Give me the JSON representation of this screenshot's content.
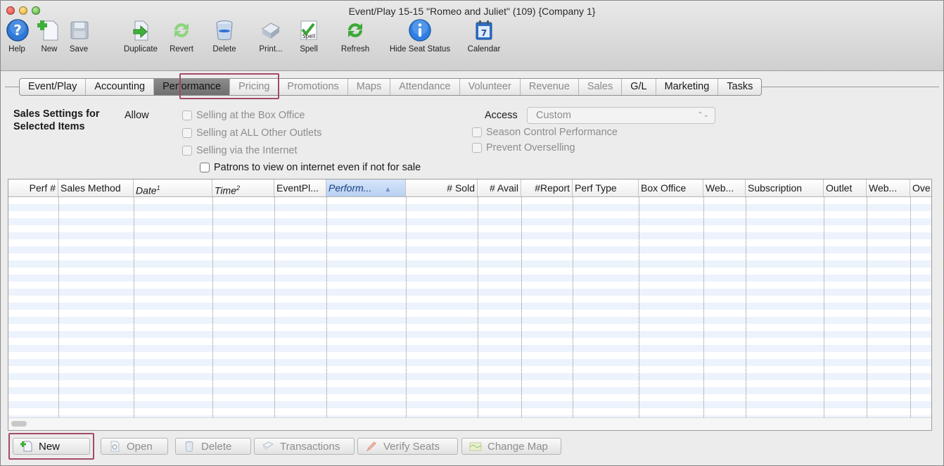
{
  "window": {
    "title": "Event/Play 15-15 \"Romeo and Juliet\" (109) {Company 1}"
  },
  "toolbar": {
    "items": [
      {
        "label": "Help",
        "icon": "help-icon"
      },
      {
        "label": "New",
        "icon": "new-doc-icon"
      },
      {
        "label": "Save",
        "icon": "floppy-icon"
      },
      {
        "label": "Duplicate",
        "icon": "duplicate-icon"
      },
      {
        "label": "Revert",
        "icon": "revert-icon"
      },
      {
        "label": "Delete",
        "icon": "trash-icon"
      },
      {
        "label": "Print...",
        "icon": "printer-icon"
      },
      {
        "label": "Spell",
        "icon": "spellcheck-icon",
        "badge": "Spell"
      },
      {
        "label": "Refresh",
        "icon": "refresh-icon"
      },
      {
        "label": "Hide Seat Status",
        "icon": "info-icon"
      },
      {
        "label": "Calendar",
        "icon": "calendar-icon",
        "badge": "7"
      }
    ]
  },
  "tabs": [
    {
      "label": "Event/Play",
      "state": "normal"
    },
    {
      "label": "Accounting",
      "state": "normal"
    },
    {
      "label": "Performance",
      "state": "active"
    },
    {
      "label": "Pricing",
      "state": "dim"
    },
    {
      "label": "Promotions",
      "state": "dim"
    },
    {
      "label": "Maps",
      "state": "dim"
    },
    {
      "label": "Attendance",
      "state": "dim"
    },
    {
      "label": "Volunteer",
      "state": "dim"
    },
    {
      "label": "Revenue",
      "state": "dim"
    },
    {
      "label": "Sales",
      "state": "dim"
    },
    {
      "label": "G/L",
      "state": "normal"
    },
    {
      "label": "Marketing",
      "state": "normal"
    },
    {
      "label": "Tasks",
      "state": "normal"
    }
  ],
  "settings": {
    "title": "Sales Settings for Selected Items",
    "allow_label": "Allow",
    "allow_options": [
      {
        "label": "Selling at the Box Office",
        "checked": false,
        "enabled": false
      },
      {
        "label": "Selling at ALL Other Outlets",
        "checked": false,
        "enabled": false
      },
      {
        "label": "Selling via the Internet",
        "checked": false,
        "enabled": false
      }
    ],
    "patrons_view": {
      "label": "Patrons to view on internet even if not for sale",
      "checked": false,
      "enabled": true
    },
    "access_label": "Access",
    "access_value": "Custom",
    "access_arrows": "⌃⌄",
    "season_control": {
      "label": "Season Control Performance",
      "checked": false,
      "enabled": false
    },
    "prevent_overselling": {
      "label": "Prevent Overselling",
      "checked": false,
      "enabled": false
    }
  },
  "table": {
    "columns": [
      {
        "label": "Perf #",
        "align": "right"
      },
      {
        "label": "Sales Method",
        "align": "left"
      },
      {
        "label": "Date",
        "sup": "1",
        "italic": true
      },
      {
        "label": "Time",
        "sup": "2",
        "italic": true
      },
      {
        "label": "EventPl...",
        "align": "left"
      },
      {
        "label": "Perform...",
        "sorted": true,
        "sort_indicator": "▲"
      },
      {
        "label": "# Sold",
        "align": "right"
      },
      {
        "label": "# Avail",
        "align": "right"
      },
      {
        "label": "#Report",
        "align": "right"
      },
      {
        "label": "Perf Type",
        "align": "left"
      },
      {
        "label": "Box Office",
        "align": "left"
      },
      {
        "label": "Web...",
        "align": "left"
      },
      {
        "label": "Subscription",
        "align": "left"
      },
      {
        "label": "Outlet",
        "align": "left"
      },
      {
        "label": "Web...",
        "align": "left"
      },
      {
        "label": "Ove.",
        "align": "left"
      }
    ],
    "rows": []
  },
  "buttons": [
    {
      "label": "New",
      "enabled": true,
      "icon": "new-icon"
    },
    {
      "label": "Open",
      "enabled": false,
      "icon": "open-icon"
    },
    {
      "label": "Delete",
      "enabled": false,
      "icon": "delete-icon"
    },
    {
      "label": "Transactions",
      "enabled": false,
      "icon": "transactions-icon"
    },
    {
      "label": "Verify Seats",
      "enabled": false,
      "icon": "verify-seats-icon"
    },
    {
      "label": "Change Map",
      "enabled": false,
      "icon": "map-icon"
    }
  ],
  "colors": {
    "highlight": "#a34a6b",
    "row_stripe": "#edf3fd",
    "sorted_header": "#b9d0f1"
  }
}
